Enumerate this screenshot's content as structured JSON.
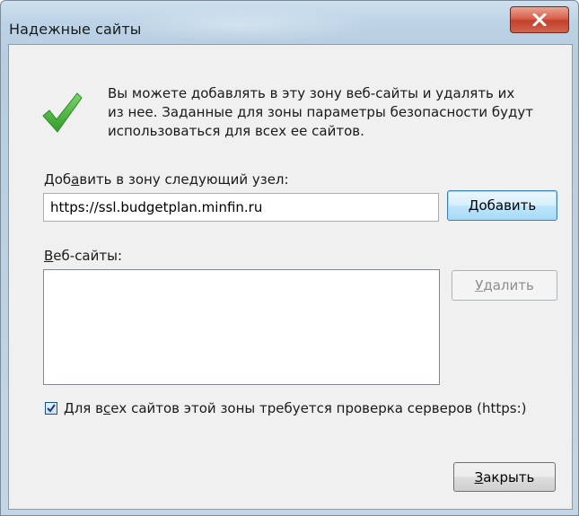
{
  "window": {
    "title": "Надежные сайты",
    "close_glyph": "X"
  },
  "info": {
    "line1": "Вы можете добавлять в эту зону  веб-сайты и удалять их",
    "line2": "из нее. Заданные для зоны параметры безопасности будут",
    "line3": "использоваться для всех ее сайтов."
  },
  "add_zone": {
    "label_pre": "Доб",
    "label_accel": "а",
    "label_post": "вить в зону следующий узел:",
    "input_value": "https://ssl.budgetplan.minfin.ru",
    "add_button": "Добавить"
  },
  "sites": {
    "label_accel": "В",
    "label_post": "еб-сайты:",
    "items": [],
    "remove_accel": "У",
    "remove_post": "далить"
  },
  "https_check": {
    "checked": true,
    "label_pre": "Для в",
    "label_accel": "с",
    "label_post": "ех сайтов этой зоны требуется проверка серверов (https:)"
  },
  "footer": {
    "close_accel": "З",
    "close_post": "акрыть"
  },
  "colors": {
    "check_green": "#3fae3a",
    "close_red": "#c7432f",
    "dialog_bg": "#f0f0f0"
  },
  "icons": {
    "info": "green-checkmark-icon",
    "window_close": "close-icon",
    "checkbox": "checkbox-checked-icon"
  }
}
